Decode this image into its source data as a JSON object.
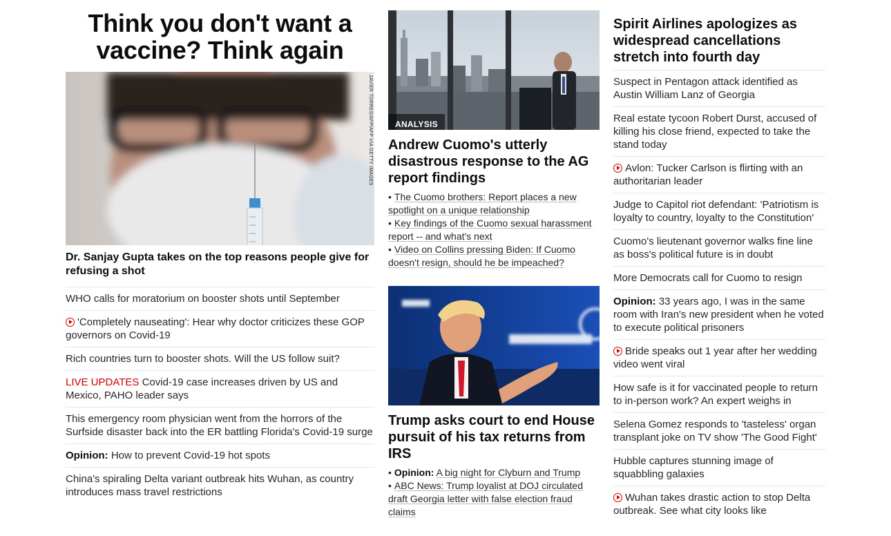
{
  "left": {
    "headline": "Think you don't want a vaccine? Think again",
    "photo_credit": "JAVIER TORRES/AFP/AFP VIA GETTY IMAGES",
    "lead_caption": "Dr. Sanjay Gupta takes on the top reasons people give for refusing a shot",
    "items": [
      {
        "prefix": "",
        "text": "WHO calls for moratorium on booster shots until September",
        "video": false
      },
      {
        "prefix": "",
        "text": "'Completely nauseating': Hear why doctor criticizes these GOP governors on Covid-19",
        "video": true
      },
      {
        "prefix": "",
        "text": "Rich countries turn to booster shots. Will the US follow suit?",
        "video": false
      },
      {
        "prefix": "LIVE UPDATES",
        "text": "Covid-19 case increases driven by US and Mexico, PAHO leader says",
        "video": false,
        "live": true
      },
      {
        "prefix": "",
        "text": "This emergency room physician went from the horrors of the Surfside disaster back into the ER battling Florida's Covid-19 surge",
        "video": false
      },
      {
        "prefix": "Opinion:",
        "text": "How to prevent Covid-19 hot spots",
        "video": false
      },
      {
        "prefix": "",
        "text": "China's spiraling Delta variant outbreak hits Wuhan, as country introduces mass travel restrictions",
        "video": false
      }
    ]
  },
  "middle": {
    "story1": {
      "badge": "ANALYSIS",
      "headline": "Andrew Cuomo's utterly disastrous response to the AG report findings",
      "related": [
        {
          "prefix": "",
          "text": "The Cuomo brothers: Report places a new spotlight on a unique relationship"
        },
        {
          "prefix": "",
          "text": "Key findings of the Cuomo sexual harassment report -- and what's next"
        },
        {
          "prefix": "",
          "text": "Video on Collins pressing Biden: If Cuomo doesn't resign, should he be impeached?"
        }
      ]
    },
    "story2": {
      "headline": "Trump asks court to end House pursuit of his tax returns from IRS",
      "related": [
        {
          "prefix": "Opinion:",
          "text": "A big night for Clyburn and Trump"
        },
        {
          "prefix": "",
          "text": "ABC News: Trump loyalist at DOJ circulated draft Georgia letter with false election fraud claims"
        }
      ]
    }
  },
  "right": {
    "headline": "Spirit Airlines apologizes as widespread cancellations stretch into fourth day",
    "items": [
      {
        "prefix": "",
        "text": "Suspect in Pentagon attack identified as Austin William Lanz of Georgia",
        "video": false
      },
      {
        "prefix": "",
        "text": "Real estate tycoon Robert Durst, accused of killing his close friend, expected to take the stand today",
        "video": false
      },
      {
        "prefix": "",
        "text": "Avlon: Tucker Carlson is flirting with an authoritarian leader",
        "video": true
      },
      {
        "prefix": "",
        "text": "Judge to Capitol riot defendant: 'Patriotism is loyalty to country, loyalty to the Constitution'",
        "video": false
      },
      {
        "prefix": "",
        "text": "Cuomo's lieutenant governor walks fine line as boss's political future is in doubt",
        "video": false
      },
      {
        "prefix": "",
        "text": "More Democrats call for Cuomo to resign",
        "video": false
      },
      {
        "prefix": "Opinion:",
        "text": "33 years ago, I was in the same room with Iran's new president when he voted to execute political prisoners",
        "video": false
      },
      {
        "prefix": "",
        "text": "Bride speaks out 1 year after her wedding video went viral",
        "video": true
      },
      {
        "prefix": "",
        "text": "How safe is it for vaccinated people to return to in-person work? An expert weighs in",
        "video": false
      },
      {
        "prefix": "",
        "text": "Selena Gomez responds to 'tasteless' organ transplant joke on TV show 'The Good Fight'",
        "video": false
      },
      {
        "prefix": "",
        "text": "Hubble captures stunning image of squabbling galaxies",
        "video": false
      },
      {
        "prefix": "",
        "text": "Wuhan takes drastic action to stop Delta outbreak. See what city looks like",
        "video": true
      }
    ]
  },
  "colors": {
    "accent_red": "#cc0000",
    "text": "#262626",
    "divider": "#e6e6e6"
  },
  "icons": {
    "video": "play-circle-icon"
  }
}
